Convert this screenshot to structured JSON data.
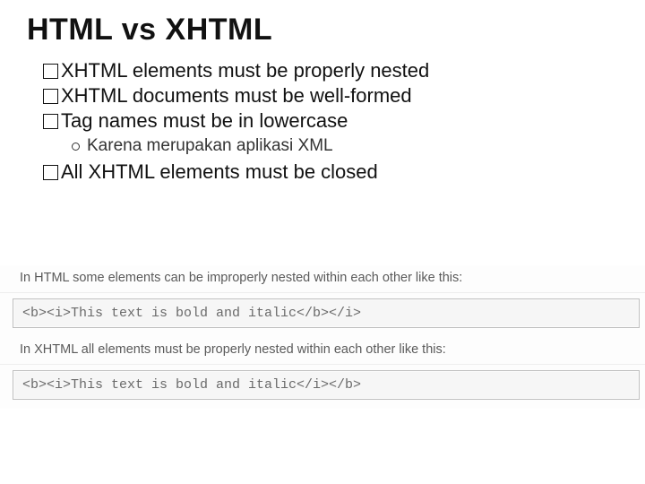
{
  "title": "HTML vs XHTML",
  "bullets": {
    "b1": "XHTML elements must be properly nested",
    "b2": "XHTML documents must be well-formed",
    "b3": "Tag names must be in lowercase",
    "sub1": "Karena merupakan aplikasi XML",
    "b4": "All XHTML elements must be closed"
  },
  "examples": {
    "cap1": "In HTML some elements can be improperly nested within each other like this:",
    "code1": "<b><i>This text is bold and italic</b></i>",
    "cap2": "In XHTML all elements must be properly nested within each other like this:",
    "code2": "<b><i>This text is bold and italic</i></b>"
  }
}
